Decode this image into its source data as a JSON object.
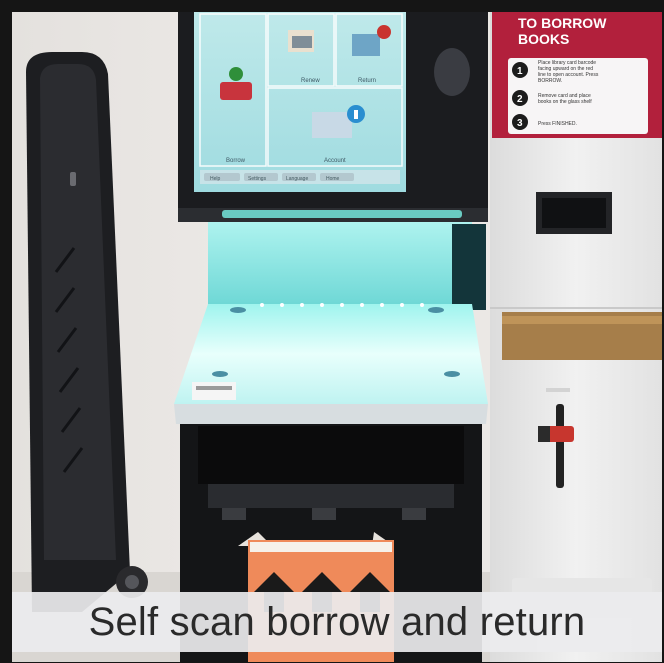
{
  "image": {
    "kind": "photo",
    "subject": "library self-service kiosk"
  },
  "caption": {
    "text": "Self scan borrow and return"
  },
  "screen": {
    "tiles": [
      {
        "icon": "renew-icon",
        "label": "Renew"
      },
      {
        "icon": "return-icon",
        "label": "Return"
      },
      {
        "icon": "borrow-icon",
        "label": "Borrow"
      },
      {
        "icon": "account-icon",
        "label": "Account"
      }
    ],
    "bottom_bar": [
      "Help",
      "Settings",
      "Language",
      "Home"
    ]
  },
  "instruction_sign": {
    "title_line1": "TO BORROW",
    "title_line2": "BOOKS",
    "steps": [
      {
        "number": "1",
        "line1": "Place library card barcode",
        "line2": "facing upward on the red",
        "line3": "line to open account. Press",
        "line4": "BORROW."
      },
      {
        "number": "2",
        "line1": "Remove card and place",
        "line2": "books on the glass shelf",
        "line3": "",
        "line4": ""
      },
      {
        "number": "3",
        "line1": "Press FINISHED.",
        "line2": "",
        "line3": "",
        "line4": ""
      }
    ]
  },
  "colors": {
    "kiosk_black": "#1b1c1f",
    "sign_red": "#b2203c",
    "scanner_glow": "#7fe3e0",
    "wall": "#ece9e6",
    "orange_label": "#ef8a5a"
  }
}
